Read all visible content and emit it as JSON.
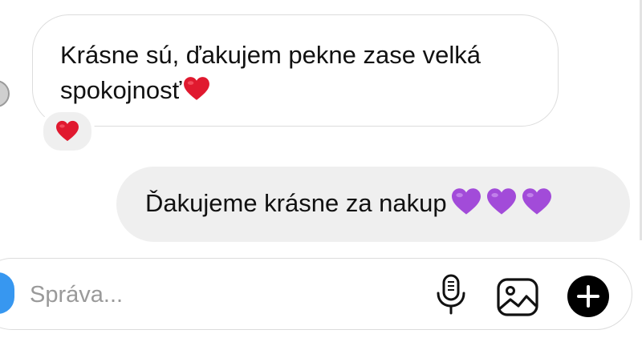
{
  "messages": [
    {
      "direction": "incoming",
      "text": "Krásne sú, ďakujem pekne zase velká spokojnosť",
      "trailing_emoji": "red-heart",
      "reaction": "red-heart"
    },
    {
      "direction": "outgoing",
      "text": "Ďakujeme krásne za nakup",
      "trailing_emoji": [
        "purple-heart",
        "purple-heart",
        "purple-heart"
      ]
    }
  ],
  "composer": {
    "placeholder": "Správa...",
    "icons": [
      "camera-icon",
      "microphone-icon",
      "gallery-icon",
      "plus-icon"
    ]
  },
  "colors": {
    "incoming_bubble_border": "#dcdcdc",
    "outgoing_bubble_bg": "#efefef",
    "red_heart": "#e0192f",
    "purple_heart": "#a24bd9",
    "camera_accent": "#3797f0",
    "placeholder_text": "#9a9a9a"
  }
}
